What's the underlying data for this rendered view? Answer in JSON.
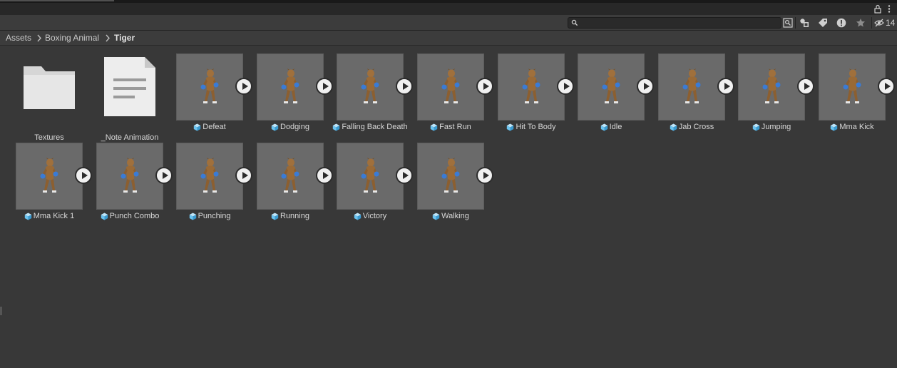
{
  "window": {
    "hidden_count": "14"
  },
  "search": {
    "value": "",
    "placeholder": ""
  },
  "breadcrumb": [
    "Assets",
    "Boxing Animal",
    "Tiger"
  ],
  "folder": {
    "label": "Textures",
    "icon": "folder-icon"
  },
  "note": {
    "label": "_Note Animation",
    "icon": "document-icon"
  },
  "animations": [
    {
      "label": "Defeat"
    },
    {
      "label": "Dodging"
    },
    {
      "label": "Falling Back Death"
    },
    {
      "label": "Fast Run"
    },
    {
      "label": "Hit To Body"
    },
    {
      "label": "Idle"
    },
    {
      "label": "Jab Cross"
    },
    {
      "label": "Jumping"
    },
    {
      "label": "Mma Kick"
    },
    {
      "label": "Mma Kick 1"
    },
    {
      "label": "Punch Combo"
    },
    {
      "label": "Punching"
    },
    {
      "label": "Running"
    },
    {
      "label": "Victory"
    },
    {
      "label": "Walking"
    }
  ],
  "colors": {
    "background": "#383838",
    "thumb": "#6a6a6a",
    "cube_icon": "#6cc4f0",
    "glove": "#3a7bd5",
    "fur": "#a0703c"
  }
}
